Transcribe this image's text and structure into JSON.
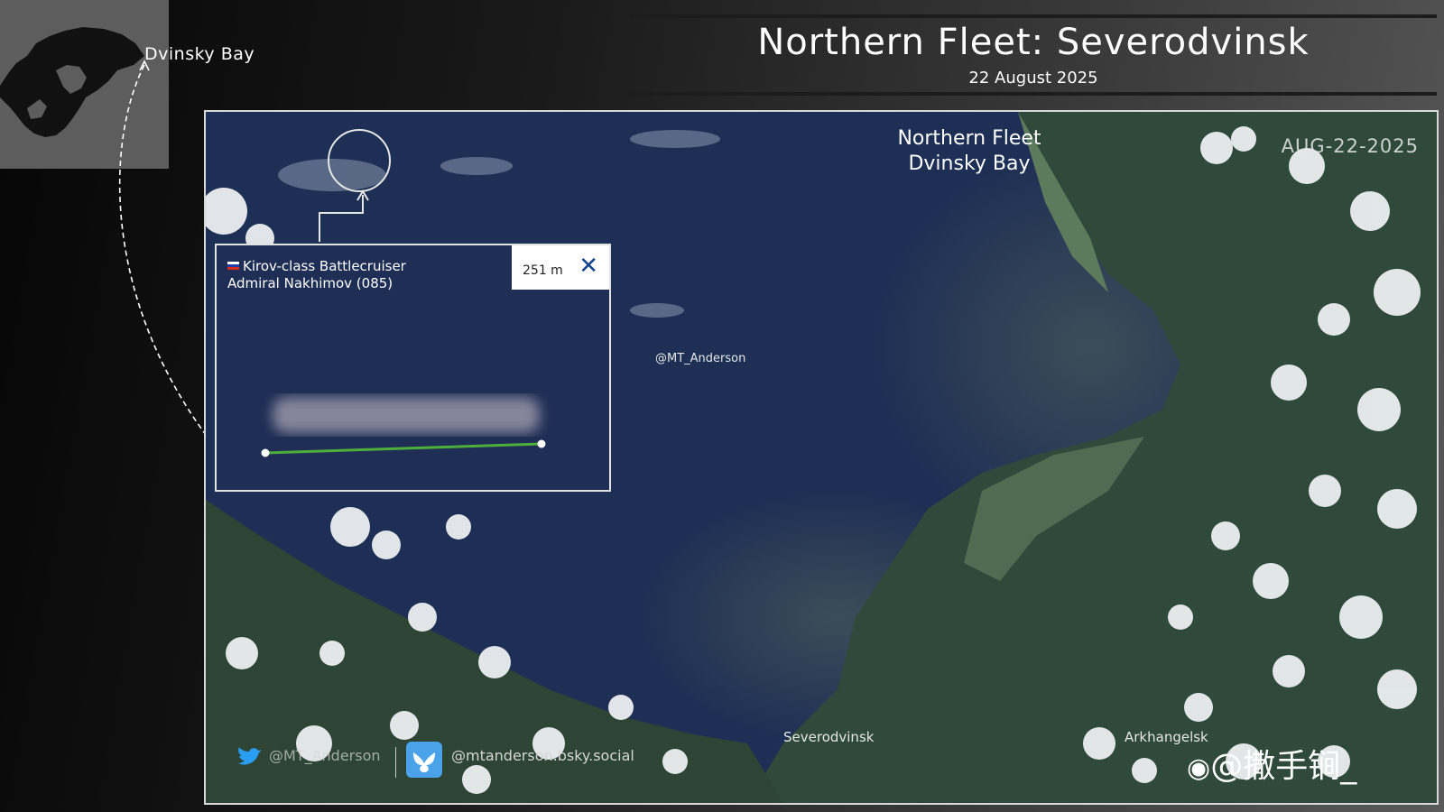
{
  "header": {
    "title": "Northern Fleet: Severodvinsk",
    "date": "22 August 2025"
  },
  "inset": {
    "location_label": "Dvinsky Bay"
  },
  "map": {
    "title_line1": "Northern Fleet",
    "title_line2": "Dvinsky Bay",
    "image_date": "AUG-22-2025",
    "credit": "@MT_Anderson",
    "places": {
      "severodvinsk": "Severodvinsk",
      "arkhangelsk": "Arkhangelsk"
    }
  },
  "callout": {
    "flag": "Russia",
    "ship_class": "Kirov-class Battlecruiser",
    "ship_name": "Admiral Nakhimov (085)",
    "length": "251 m"
  },
  "footer": {
    "twitter_handle": "@MT_Anderson",
    "bluesky_handle": "@mtanderson.bsky.social",
    "watermark": "@撒手锏_"
  },
  "colors": {
    "sea": "#1e2f55",
    "land": "#2e4a38",
    "measure_line": "#4caf3a",
    "close_icon": "#14448a"
  }
}
